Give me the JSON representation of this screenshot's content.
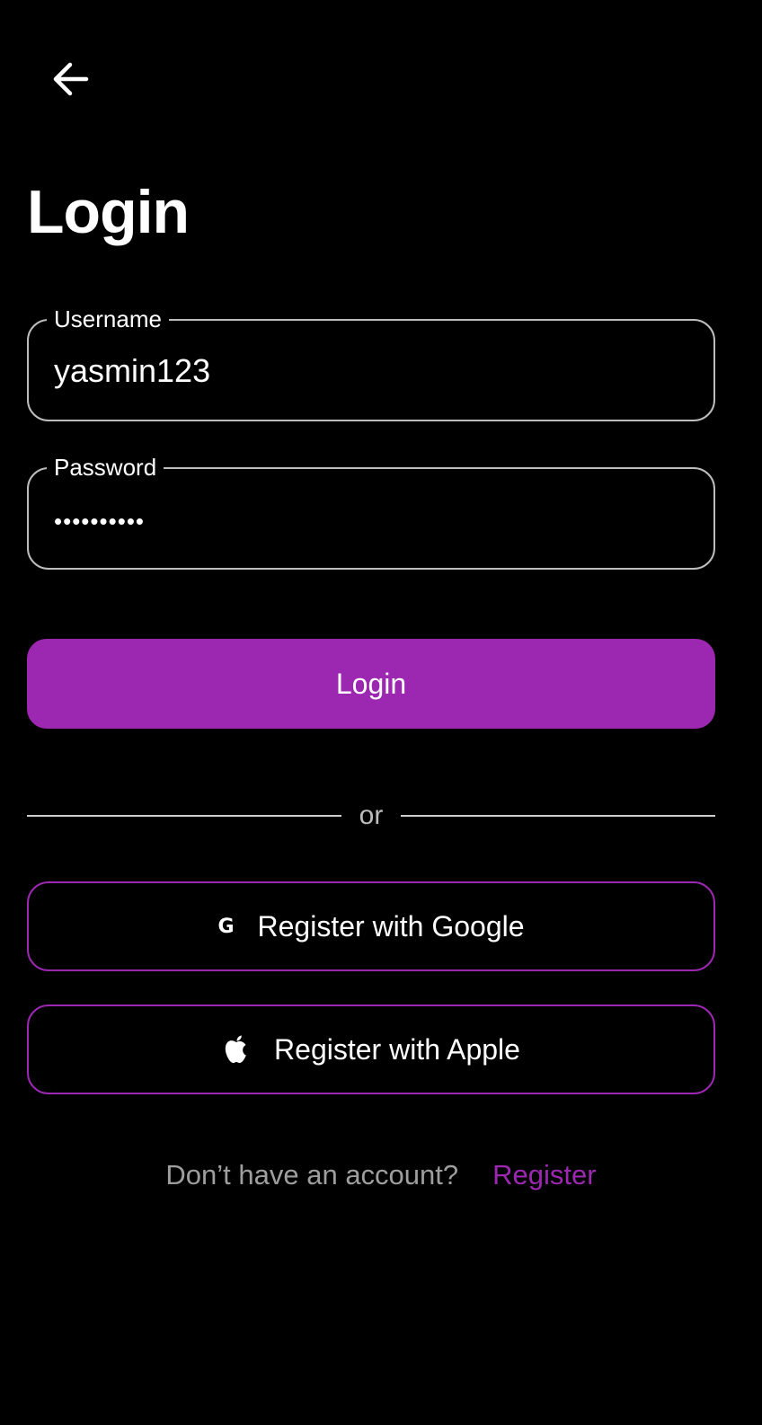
{
  "header": {
    "back_icon": "arrow-left-icon",
    "title": "Login"
  },
  "form": {
    "username": {
      "label": "Username",
      "value": "yasmin123"
    },
    "password": {
      "label": "Password",
      "masked_value": "••••••••••"
    },
    "login_button": "Login"
  },
  "divider_text": "or",
  "social": {
    "google": {
      "icon": "google-g-icon",
      "icon_glyph": "G",
      "label": "Register with Google"
    },
    "apple": {
      "icon": "apple-icon",
      "label": "Register with Apple"
    }
  },
  "footer": {
    "question": "Don’t have an account?",
    "register_link": "Register"
  },
  "colors": {
    "background": "#000000",
    "accent": "#9c27b0",
    "text_primary": "#ffffff",
    "text_secondary": "#9e9e9e",
    "field_border": "#bdbdbd"
  }
}
